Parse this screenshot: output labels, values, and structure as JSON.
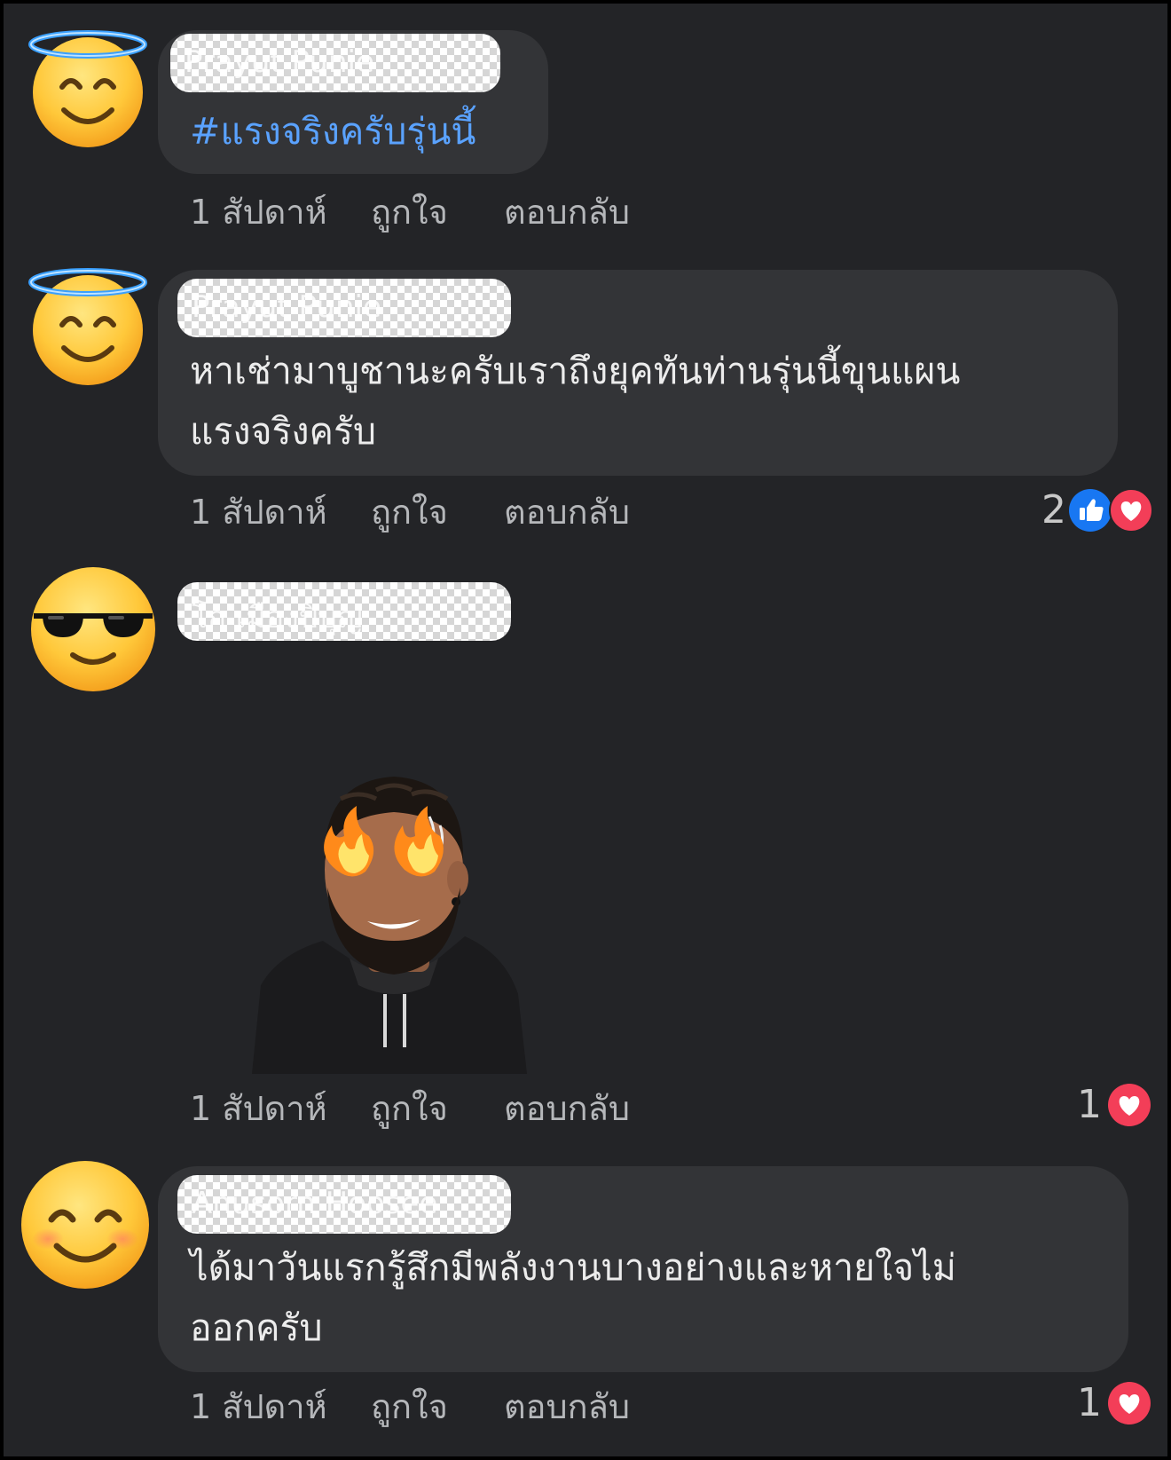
{
  "comments": [
    {
      "author": "Prayut Punie",
      "text": "#แรงจริงครับรุ่นนี้",
      "time": "1 สัปดาห์",
      "like_label": "ถูกใจ",
      "reply_label": "ตอบกลับ",
      "avatar": "smiling-halo-icon"
    },
    {
      "author": "Prayut Punie",
      "text_line1": "หาเช่ามาบูชานะครับเราถึงยุคทันท่านรุ่นนี้ขุนแผน",
      "text_line2": "แรงจริงครับ",
      "time": "1 สัปดาห์",
      "like_label": "ถูกใจ",
      "reply_label": "ตอบกลับ",
      "reaction_count": "2",
      "reactions": [
        "like-icon",
        "love-icon"
      ],
      "avatar": "smiling-halo-icon"
    },
    {
      "author": "โก เมืองปิ่บุญ",
      "sticker": "avatar-sticker-fire-eyes",
      "time": "1 สัปดาห์",
      "like_label": "ถูกใจ",
      "reply_label": "ตอบกลับ",
      "reaction_count": "1",
      "reactions": [
        "love-icon"
      ],
      "avatar": "sunglasses-face-icon"
    },
    {
      "author": "Anusorn Hoosee",
      "text_line1": "ได้มาวันแรกรู้สึกมีพลังงานบางอย่างและหายใจไม่",
      "text_line2": "ออกครับ",
      "time": "1 สัปดาห์",
      "like_label": "ถูกใจ",
      "reply_label": "ตอบกลับ",
      "reaction_count": "1",
      "reactions": [
        "love-icon"
      ],
      "avatar": "smiling-blush-icon"
    }
  ],
  "colors": {
    "background": "#232427",
    "bubble": "#333437",
    "hashtag": "#5aa2ff",
    "like": "#1877f2",
    "love": "#f33e58"
  }
}
